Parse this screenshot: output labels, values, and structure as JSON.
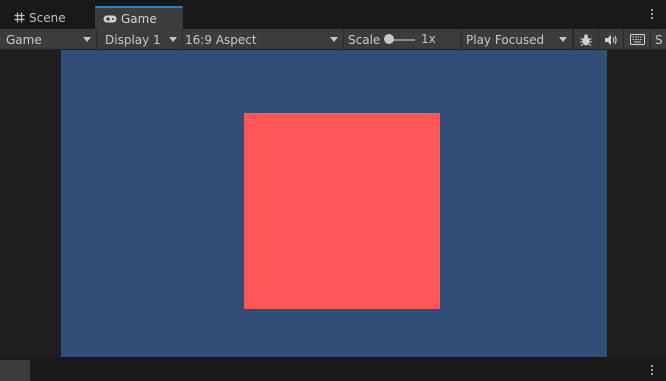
{
  "tabs": [
    {
      "label": "Scene",
      "icon": "grid-icon"
    },
    {
      "label": "Game",
      "icon": "gamepad-icon",
      "active": true
    }
  ],
  "toolbar": {
    "target": "Game",
    "display": "Display 1",
    "aspect": "16:9 Aspect",
    "scale_label": "Scale",
    "scale_value": "1x",
    "play_mode": "Play Focused",
    "truncated_label": "S"
  },
  "colors": {
    "game_background": "#304e78",
    "sprite": "#ff5757",
    "active_tab_accent": "#3a79bb"
  }
}
